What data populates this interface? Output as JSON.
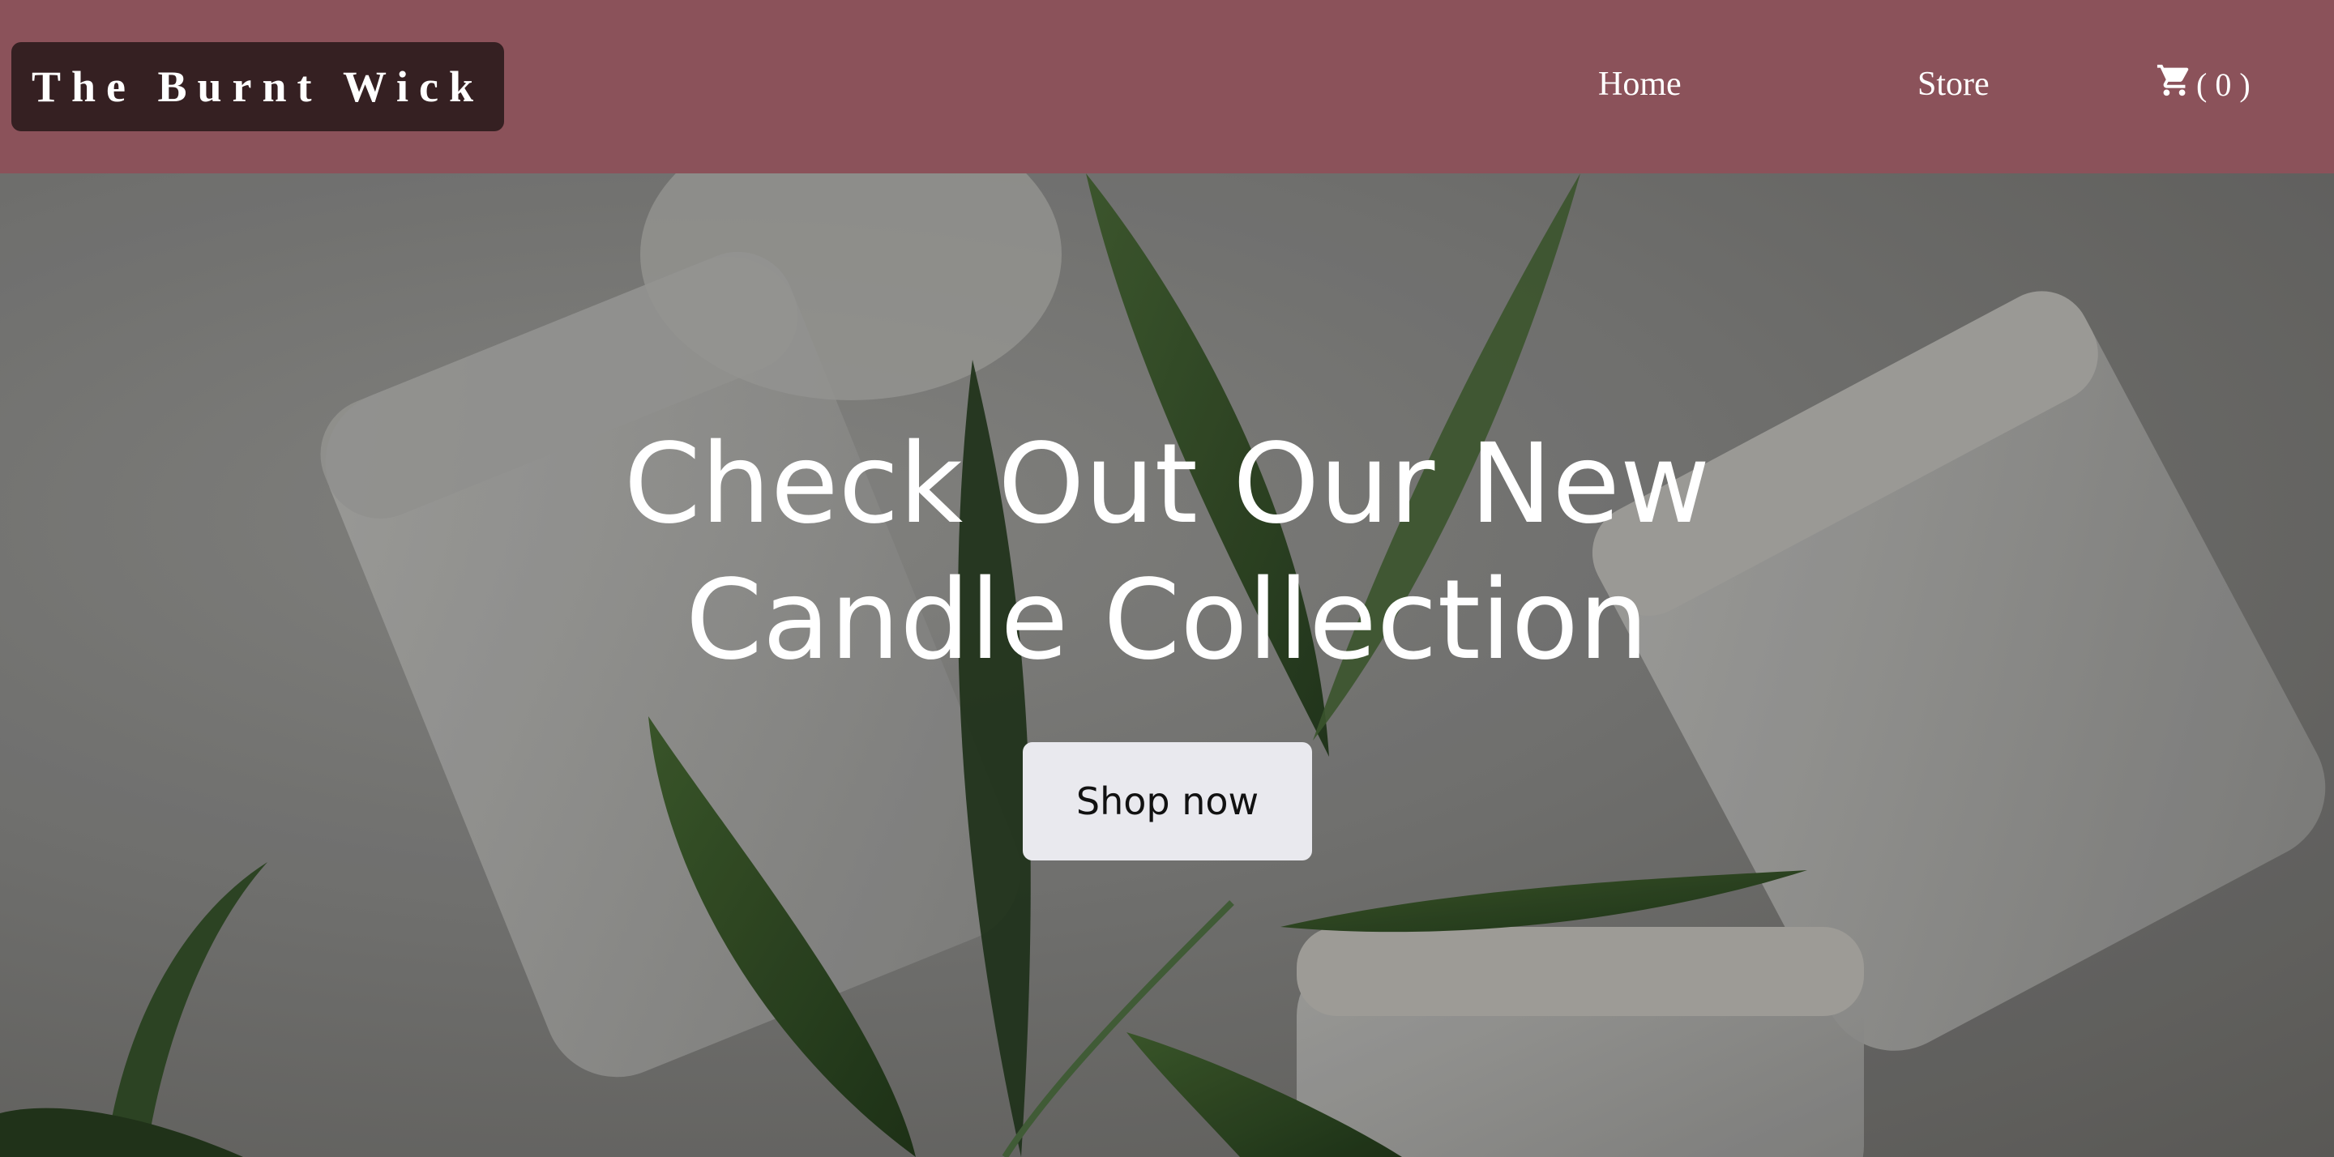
{
  "header": {
    "brand": "The Burnt Wick",
    "nav": {
      "home": "Home",
      "store": "Store"
    },
    "cart": {
      "icon": "cart-icon",
      "count_label": "( 0 )"
    },
    "colors": {
      "navbar": "#8b525a",
      "logo_background": "#352022"
    }
  },
  "hero": {
    "title_line1": "Check Out Our New",
    "title_line2": "Candle Collection",
    "cta_label": "Shop now",
    "background_image": "candle jars with eucalyptus leaves"
  }
}
